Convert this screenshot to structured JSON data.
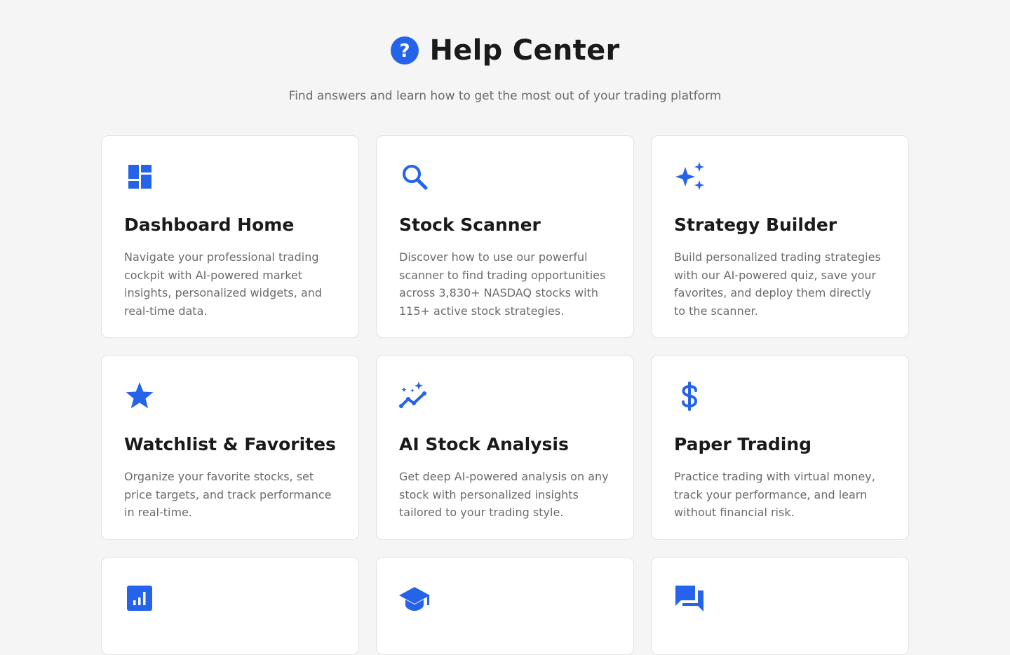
{
  "header": {
    "icon": "question-circle-icon",
    "title": "Help Center",
    "subtitle": "Find answers and learn how to get the most out of your trading platform"
  },
  "colors": {
    "accent": "#2563eb",
    "background": "#f5f5f5",
    "card": "#ffffff",
    "title_text": "#1a1a1a",
    "muted_text": "#6b6b6b"
  },
  "cards": [
    {
      "icon": "dashboard-icon",
      "title": "Dashboard Home",
      "description": "Navigate your professional trading cockpit with AI-powered market insights, personalized widgets, and real-time data."
    },
    {
      "icon": "search-icon",
      "title": "Stock Scanner",
      "description": "Discover how to use our powerful scanner to find trading opportunities across 3,830+ NASDAQ stocks with 115+ active stock strategies."
    },
    {
      "icon": "sparkles-icon",
      "title": "Strategy Builder",
      "description": "Build personalized trading strategies with our AI-powered quiz, save your favorites, and deploy them directly to the scanner."
    },
    {
      "icon": "star-icon",
      "title": "Watchlist & Favorites",
      "description": "Organize your favorite stocks, set price targets, and track performance in real-time."
    },
    {
      "icon": "ai-trend-icon",
      "title": "AI Stock Analysis",
      "description": "Get deep AI-powered analysis on any stock with personalized insights tailored to your trading style."
    },
    {
      "icon": "dollar-icon",
      "title": "Paper Trading",
      "description": "Practice trading with virtual money, track your performance, and learn without financial risk."
    },
    {
      "icon": "bar-chart-icon",
      "title": "",
      "description": ""
    },
    {
      "icon": "graduation-cap-icon",
      "title": "",
      "description": ""
    },
    {
      "icon": "chat-bubbles-icon",
      "title": "",
      "description": ""
    }
  ]
}
